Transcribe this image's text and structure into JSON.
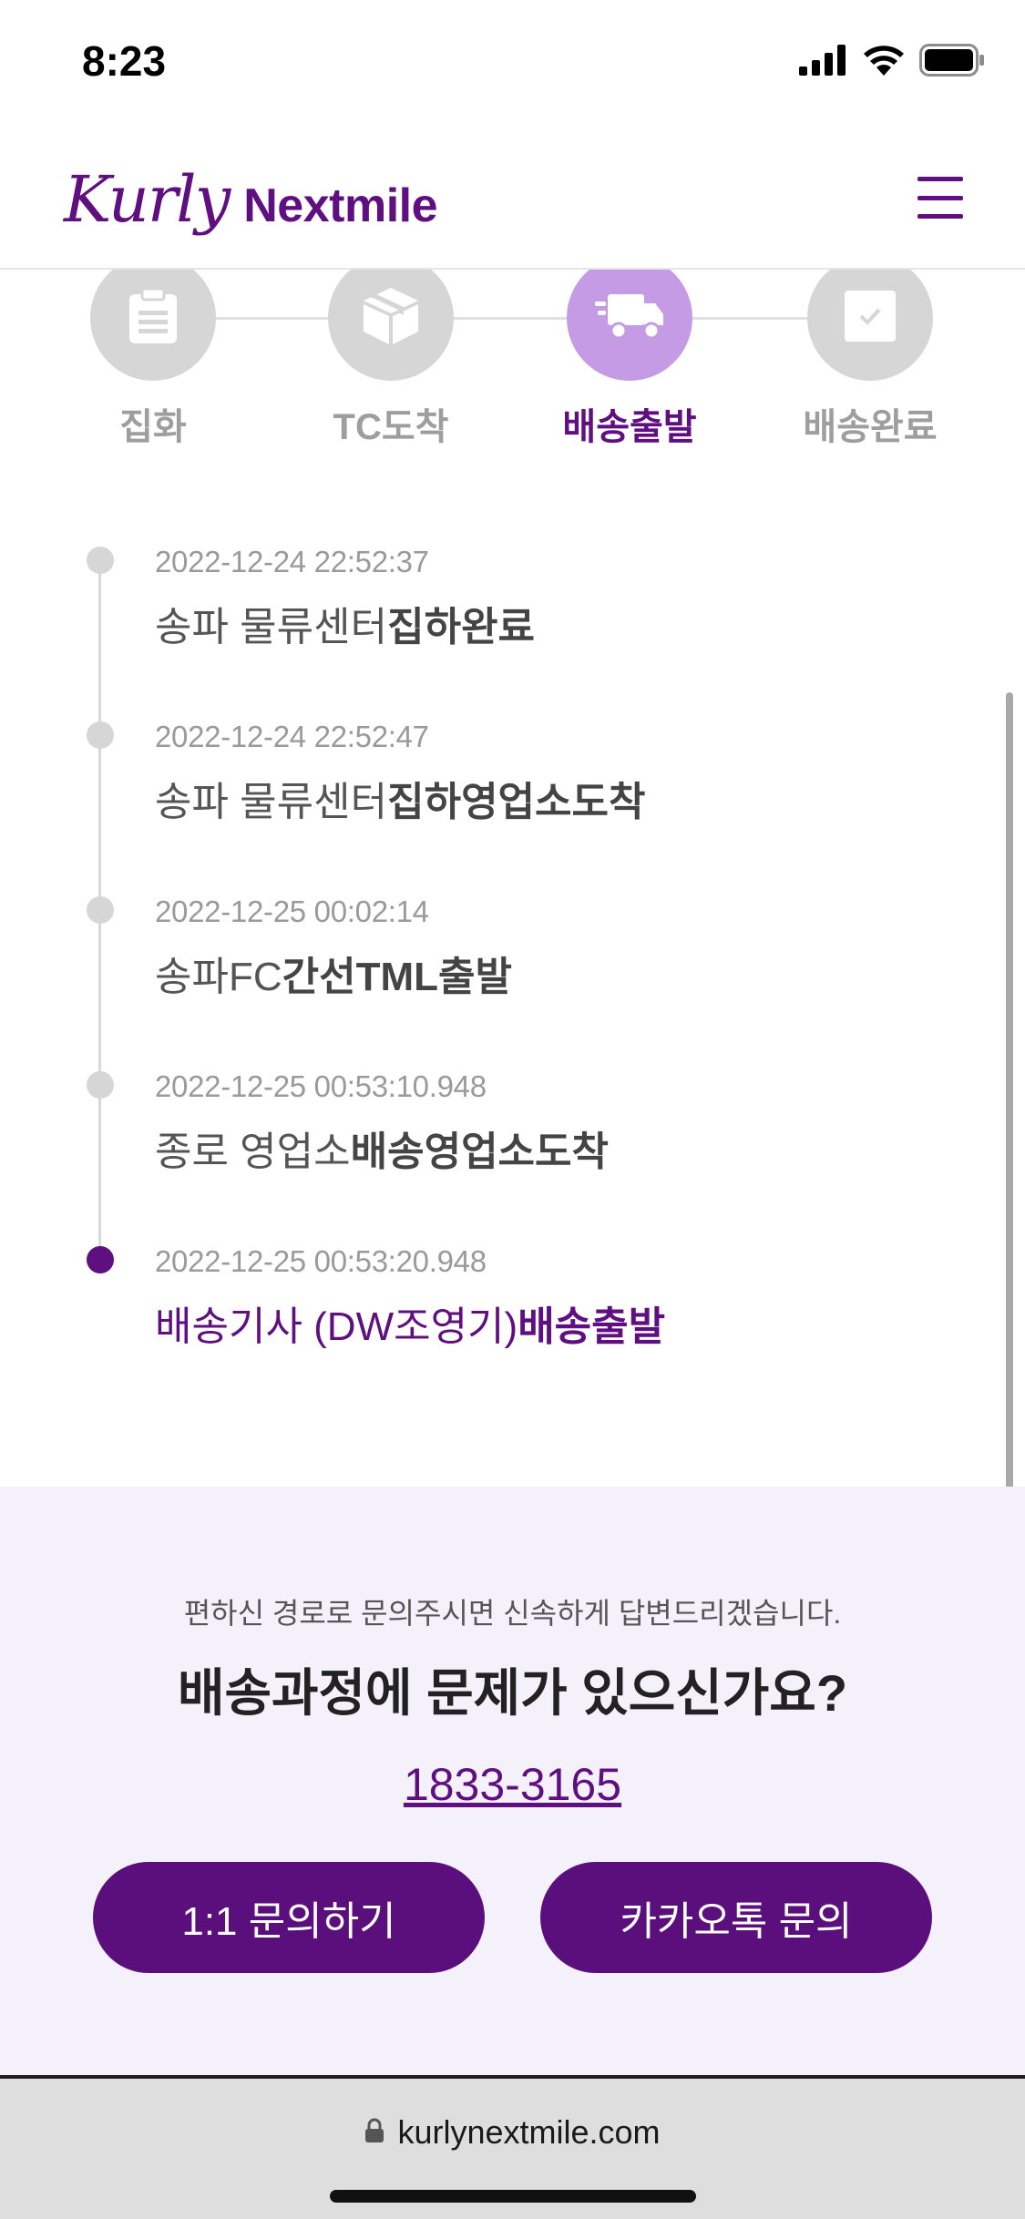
{
  "status_bar": {
    "time": "8:23"
  },
  "header": {
    "logo_kurly": "Kurly",
    "logo_nextmile": "Nextmile",
    "menu_icon": "hamburger-menu-icon"
  },
  "steps": [
    {
      "label": "집화",
      "icon": "clipboard-icon",
      "active": false
    },
    {
      "label": "TC도착",
      "icon": "box-icon",
      "active": false
    },
    {
      "label": "배송출발",
      "icon": "truck-icon",
      "active": true
    },
    {
      "label": "배송완료",
      "icon": "checkbox-icon",
      "active": false
    }
  ],
  "timeline": [
    {
      "time": "2022-12-24 22:52:37",
      "place": "송파 물류센터",
      "status": "집하완료"
    },
    {
      "time": "2022-12-24 22:52:47",
      "place": "송파 물류센터",
      "status": "집하영업소도착"
    },
    {
      "time": "2022-12-25 00:02:14",
      "place": "송파FC",
      "status": "간선TML출발"
    },
    {
      "time": "2022-12-25 00:53:10.948",
      "place": "종로 영업소",
      "status": "배송영업소도착"
    },
    {
      "time": "2022-12-25 00:53:20.948",
      "place": "배송기사 (DW조영기)",
      "status": "배송출발"
    }
  ],
  "contact": {
    "subtitle": "편하신 경로로 문의주시면 신속하게 답변드리겠습니다.",
    "title": "배송과정에 문제가 있으신가요?",
    "phone": "1833-3165",
    "inquiry_button": "1:1 문의하기",
    "kakao_button": "카카오톡 문의"
  },
  "browser": {
    "url": "kurlynextmile.com"
  },
  "colors": {
    "brand_purple": "#5f0f80",
    "active_step": "#c59be6",
    "inactive": "#d6d6d6",
    "contact_bg": "#f4f1fa"
  }
}
